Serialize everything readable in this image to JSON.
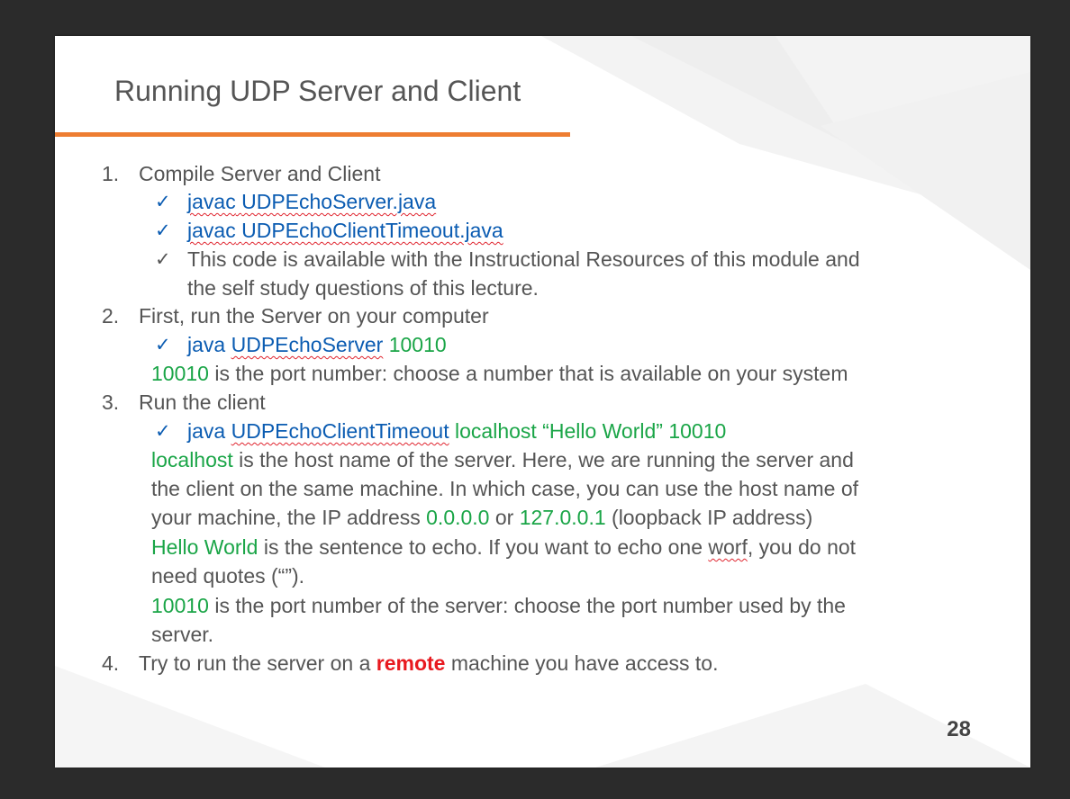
{
  "slide": {
    "title": "Running UDP Server and Client",
    "page_number": "28",
    "accent_color": "#ee7d31"
  },
  "steps": [
    {
      "number": "1.",
      "text": "Compile Server and Client",
      "checks": [
        {
          "a": "javac",
          "b": "UDPEchoServer.java"
        },
        {
          "a": "javac",
          "b": "UDPEchoClientTimeout.java"
        },
        {
          "line1": "This code is available with the Instructional Resources of this module and",
          "line2": "the self study questions of this lecture."
        }
      ]
    },
    {
      "number": "2.",
      "text": "First, run the  Server on your computer",
      "check": {
        "a": "java",
        "b": "UDPEchoServer",
        "c": "10010"
      },
      "note": {
        "a": "10010",
        "b": " is the port number: choose a number that is available on your system"
      }
    },
    {
      "number": "3.",
      "text": "Run the client",
      "check": {
        "a": "java",
        "b": "UDPEchoClientTimeout",
        "c": "localhost “Hello World” 10010"
      },
      "notes": {
        "n1_a": "localhost",
        "n1_b": " is the host name of the server. Here, we are running the server and",
        "n1_l2": "the client on the same machine. In which case, you can use the host name of",
        "n1_l3a": "your machine, the IP address ",
        "n1_l3b": "0.0.0.0",
        "n1_l3c": " or ",
        "n1_l3d": "127.0.0.1",
        "n1_l3e": " (loopback IP address)",
        "n2_a": "Hello World",
        "n2_b": " is the sentence to echo. If you want to echo one ",
        "n2_c": "worf",
        "n2_d": ", you do not",
        "n2_l2": "need quotes (“”).",
        "n3_a": "10010",
        "n3_b": " is the port number of the server: choose the port number used by the",
        "n3_l2": "server."
      }
    },
    {
      "number": "4.",
      "text_a": "Try to run the server on a ",
      "text_b": "remote",
      "text_c": " machine you have access to."
    }
  ],
  "icons": {
    "check": "check-mark-icon"
  },
  "colors": {
    "command": "#0b5cb2",
    "value": "#1aa547",
    "emphasis": "#e8191f",
    "body": "#555555"
  }
}
